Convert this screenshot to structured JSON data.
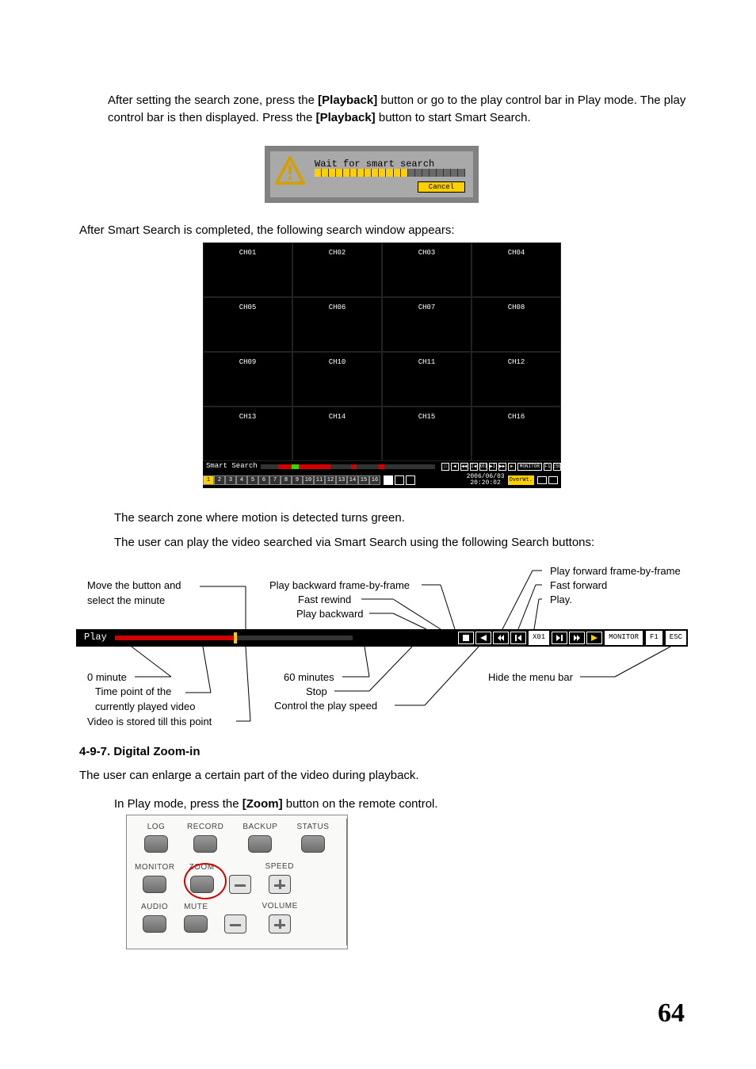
{
  "para1_a": "After setting the search zone, press the ",
  "para1_b": "[Playback]",
  "para1_c": " button or go to the play control bar in Play mode.  The play control bar is then displayed.  Press the ",
  "para1_d": "[Playback]",
  "para1_e": " button to start Smart Search.",
  "ss_dialog": {
    "message": "Wait for smart search",
    "cancel": "Cancel"
  },
  "para2": "After Smart Search is completed, the following search window appears:",
  "channels": [
    "CH01",
    "CH02",
    "CH03",
    "CH04",
    "CH05",
    "CH06",
    "CH07",
    "CH08",
    "CH09",
    "CH10",
    "CH11",
    "CH12",
    "CH13",
    "CH14",
    "CH15",
    "CH16"
  ],
  "grid_tl": {
    "label": "Smart Search",
    "speed": "X01",
    "monitor": "MONITOR",
    "f1": "F1",
    "esc": "ESC"
  },
  "grid_tabs": [
    "1",
    "2",
    "3",
    "4",
    "5",
    "6",
    "7",
    "8",
    "9",
    "10",
    "11",
    "12",
    "13",
    "14",
    "15",
    "16"
  ],
  "grid_ts_line1": "2006/06/03",
  "grid_ts_line2": "20:20:02",
  "grid_overwrite": "OverWt.",
  "para3": "The search zone where motion is detected turns green.",
  "para4": "The user can play the video searched via Smart Search using the following Search buttons:",
  "playbar": {
    "label": "Play",
    "speed": "X01",
    "monitor": "MONITOR",
    "f1": "F1",
    "esc": "ESC"
  },
  "callouts": {
    "move_select": "Move the button and\nselect the minute",
    "play_back_frame": "Play backward frame-by-frame",
    "fast_rewind": "Fast rewind",
    "play_backward": "Play backward",
    "play_fwd_frame": "Play forward frame-by-frame",
    "fast_forward": "Fast forward",
    "play": "Play.",
    "zero_min": "0 minute",
    "time_point": "Time point of the\ncurrently played video",
    "stored_till": "Video is stored till this point",
    "sixty_min": "60 minutes",
    "stop": "Stop",
    "control_speed": "Control the play speed",
    "hide_menu": "Hide the menu bar"
  },
  "heading": "4-9-7. Digital Zoom-in",
  "para5": "The user can enlarge a certain part of the video during playback.",
  "para6_a": "In Play mode, press the ",
  "para6_b": "[Zoom]",
  "para6_c": " button on the remote control.",
  "remote": {
    "r1": [
      "LOG",
      "RECORD",
      "BACKUP",
      "STATUS"
    ],
    "r2": [
      "MONITOR",
      "ZOOM",
      "",
      "SPEED"
    ],
    "r3": [
      "AUDIO",
      "MUTE",
      "",
      "VOLUME"
    ]
  },
  "page_number": "64"
}
